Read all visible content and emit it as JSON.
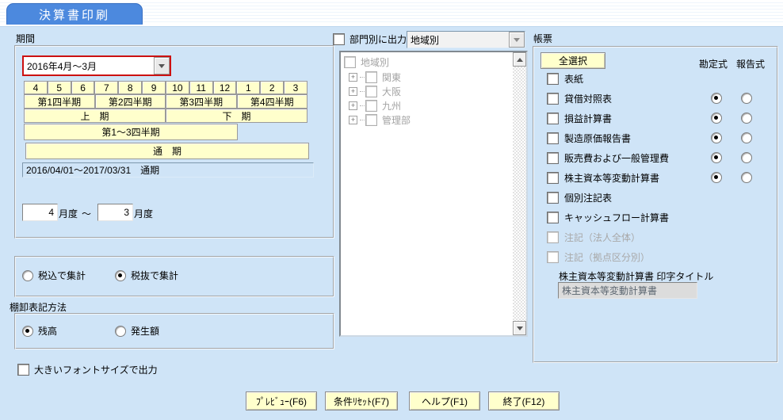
{
  "title": "決算書印刷",
  "period": {
    "label": "期間",
    "fiscal_dropdown": "2016年4月～3月",
    "months": [
      "4",
      "5",
      "6",
      "7",
      "8",
      "9",
      "10",
      "11",
      "12",
      "1",
      "2",
      "3"
    ],
    "quarters": [
      "第1四半期",
      "第2四半期",
      "第3四半期",
      "第4四半期"
    ],
    "halves": [
      "上　期",
      "下　期"
    ],
    "q1to3": "第1～3四半期",
    "full_term": "通　期",
    "range_display": "2016/04/01～2017/03/31　通期",
    "month_from": "4",
    "month_to": "3",
    "month_unit_from": "月度",
    "tilde": "～",
    "month_unit_to": "月度"
  },
  "tax": {
    "options": [
      {
        "label": "税込で集計",
        "selected": false
      },
      {
        "label": "税抜で集計",
        "selected": true
      }
    ]
  },
  "inventory": {
    "label": "棚卸表記方法",
    "options": [
      {
        "label": "残高",
        "selected": true
      },
      {
        "label": "発生額",
        "selected": false
      }
    ]
  },
  "font_option": {
    "label": "大きいフォントサイズで出力",
    "checked": false
  },
  "department": {
    "checkbox_label": "部門別に出力",
    "checked": false,
    "dropdown_value": "地域別",
    "tree": {
      "root": "地域別",
      "items": [
        "関東",
        "大阪",
        "九州",
        "管理部"
      ]
    }
  },
  "forms": {
    "label": "帳票",
    "select_all": "全選択",
    "col_account": "勘定式",
    "col_report": "報告式",
    "rows": [
      {
        "label": "表紙",
        "checked": false,
        "has_radios": false,
        "disabled": false
      },
      {
        "label": "貸借対照表",
        "checked": false,
        "has_radios": true,
        "format": "勘定式",
        "disabled": false
      },
      {
        "label": "損益計算書",
        "checked": false,
        "has_radios": true,
        "format": "勘定式",
        "disabled": false
      },
      {
        "label": "製造原価報告書",
        "checked": false,
        "has_radios": true,
        "format": "勘定式",
        "disabled": false
      },
      {
        "label": "販売費および一般管理費",
        "checked": false,
        "has_radios": true,
        "format": "勘定式",
        "disabled": false
      },
      {
        "label": "株主資本等変動計算書",
        "checked": false,
        "has_radios": true,
        "format": "勘定式",
        "disabled": false
      },
      {
        "label": "個別注記表",
        "checked": false,
        "has_radios": false,
        "disabled": false
      },
      {
        "label": "キャッシュフロー計算書",
        "checked": false,
        "has_radios": false,
        "disabled": false
      },
      {
        "label": "注記（法人全体）",
        "checked": false,
        "has_radios": false,
        "disabled": true
      },
      {
        "label": "注記（拠点区分別）",
        "checked": false,
        "has_radios": false,
        "disabled": true
      }
    ],
    "print_title_label": "株主資本等変動計算書 印字タイトル",
    "print_title_value": "株主資本等変動計算書"
  },
  "buttons": [
    {
      "label": "ﾌﾟﾚﾋﾞｭｰ(F6)"
    },
    {
      "label": "条件ﾘｾｯﾄ(F7)"
    },
    {
      "label": "ヘルプ(F1)"
    },
    {
      "label": "終了(F12)"
    }
  ],
  "colors": {
    "background": "#cfe4f7",
    "tab_blue": "#4c89de",
    "button_yellow": "#ffffcc",
    "highlight_red": "#cc1111"
  }
}
